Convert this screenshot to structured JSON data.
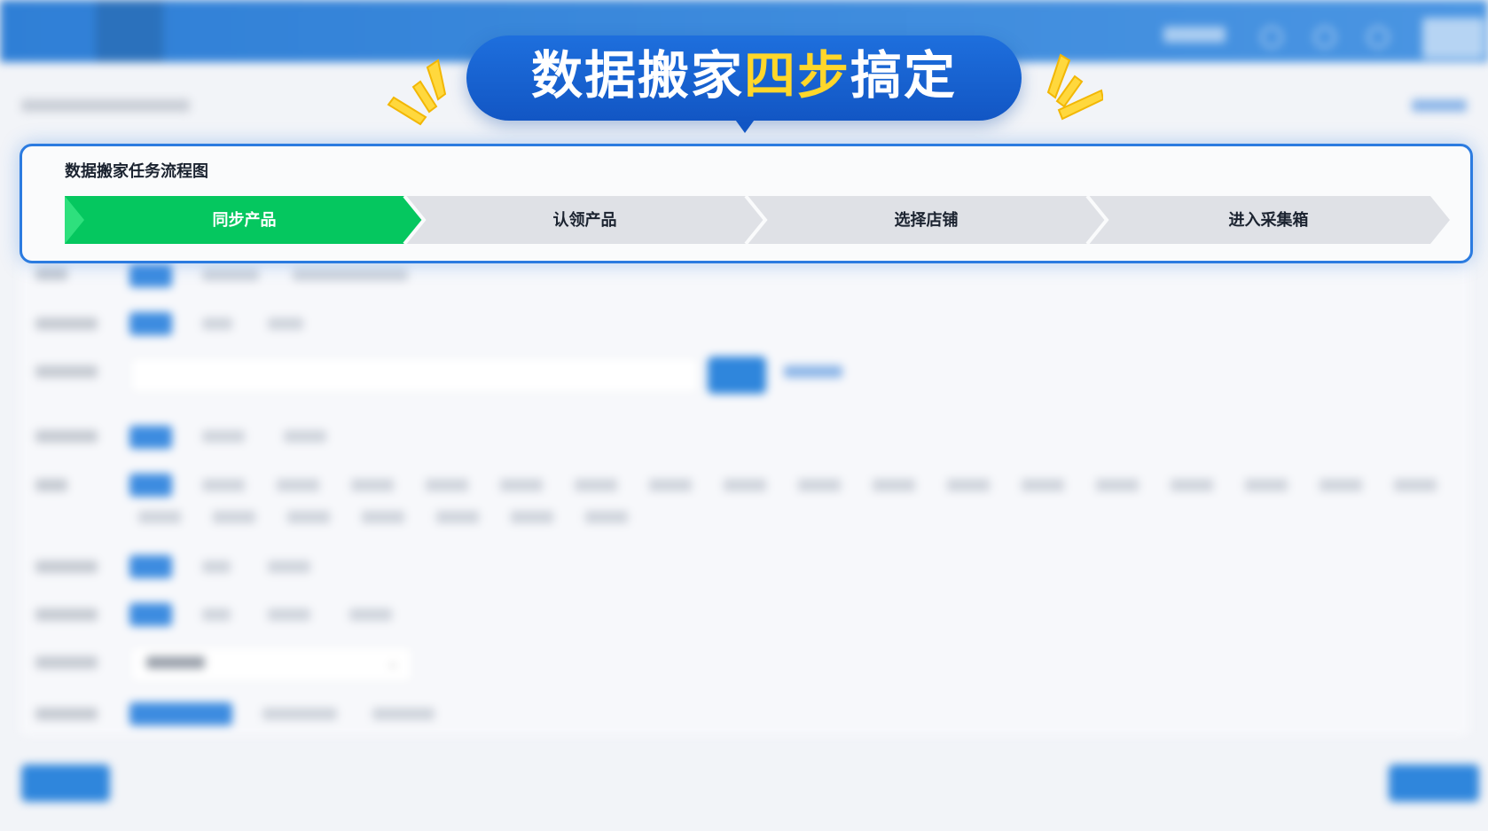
{
  "headline": {
    "part1": "数据搬家",
    "highlight": "四步",
    "part2": "搞定"
  },
  "flow": {
    "title": "数据搬家任务流程图",
    "steps": [
      {
        "label": "同步产品",
        "active": true
      },
      {
        "label": "认领产品",
        "active": false
      },
      {
        "label": "选择店铺",
        "active": false
      },
      {
        "label": "进入采集箱",
        "active": false
      }
    ]
  },
  "colors": {
    "active_step": "#05c75f",
    "inactive_step": "#dfe1e6",
    "accent": "#2b7be0",
    "highlight": "#ffd72a"
  }
}
